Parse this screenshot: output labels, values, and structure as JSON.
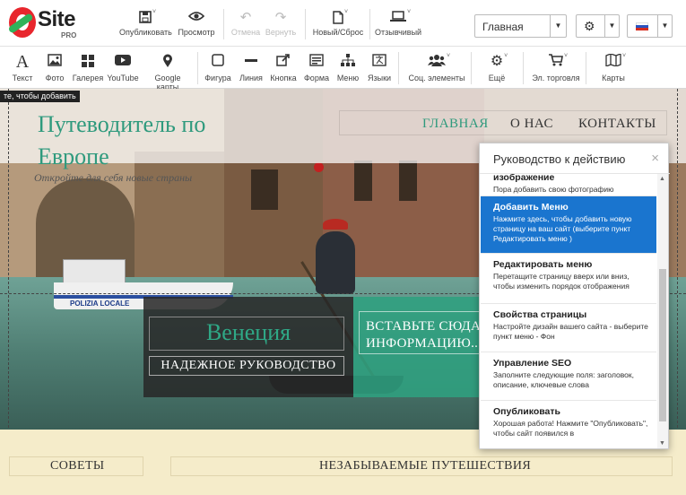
{
  "logo": {
    "name": "Site",
    "sub": "PRO"
  },
  "toolbar": {
    "publish": "Опубликовать",
    "preview": "Просмотр",
    "undo": "Отмена",
    "redo": "Вернуть",
    "new_reset": "Новый/Сброс",
    "responsive": "Отзывчивый",
    "page_select": "Главная",
    "language": "ru"
  },
  "elements": {
    "text": "Текст",
    "photo": "Фото",
    "gallery": "Галерея",
    "youtube": "YouTube",
    "google_maps": "Google карты",
    "shape": "Фигура",
    "line": "Линия",
    "button": "Кнопка",
    "form": "Форма",
    "menu": "Меню",
    "languages": "Языки",
    "social": "Соц. элементы",
    "more": "Ещё",
    "ecommerce": "Эл. торговля",
    "maps": "Карты"
  },
  "tooltip": "те, чтобы добавить",
  "site": {
    "title": "Путеводитель по Европе",
    "subtitle": "Откройте для себя новые страны",
    "nav": [
      "ГЛАВНАЯ",
      "О НАС",
      "КОНТАКТЫ"
    ],
    "hero_city": "Венеция",
    "hero_tag": "НАДЕЖНОЕ РУКОВОДСТВО",
    "hero_info": "ВСТАВЬТЕ СЮДА ИНФОРМАЦИЮ...",
    "boat_label": "POLIZIA LOCALE",
    "tips": "СОВЕТЫ",
    "trips": "НЕЗАБЫВАЕМЫЕ ПУТЕШЕСТВИЯ"
  },
  "guide": {
    "title": "Руководство к действию",
    "items": [
      {
        "title": "изображение",
        "desc": "Пора добавить свою фотографию"
      },
      {
        "title": "Добавить Меню",
        "desc": "Нажмите здесь, чтобы добавить новую страницу на ваш сайт (выберите пункт Редактировать меню )"
      },
      {
        "title": "Редактировать меню",
        "desc": "Перетащите страницу вверх или вниз, чтобы изменить порядок отображения"
      },
      {
        "title": "Свойства страницы",
        "desc": "Настройте дизайн вашего сайта - выберите пункт меню - Фон"
      },
      {
        "title": "Управление SEO",
        "desc": "Заполните следующие поля: заголовок, описание, ключевые слова"
      },
      {
        "title": "Опубликовать",
        "desc": "Хорошая работа! Нажмите \"Опубликовать\", чтобы сайт появился в"
      }
    ]
  },
  "colors": {
    "accent_green": "#2f9a7d",
    "selected_blue": "#1a75cf",
    "brand_red": "#e8262d"
  }
}
